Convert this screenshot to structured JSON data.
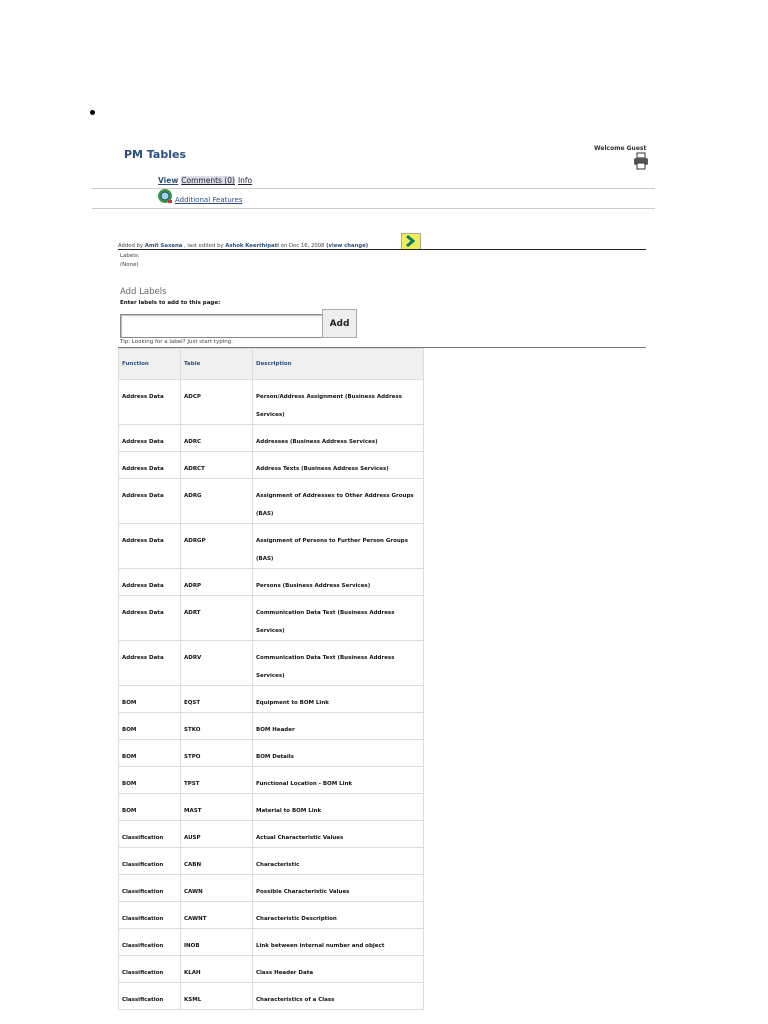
{
  "page": {
    "title": "PM Tables",
    "welcome": "Welcome Guest"
  },
  "tabs": {
    "view": "View",
    "comments": "Comments (0)",
    "info": "Info"
  },
  "additional_features": "Additional Features",
  "meta": {
    "added_by_prefix": "Added by",
    "author": "Amit Saxena",
    "edited_prefix": ", last edited by",
    "editor": "Ashok Keerthipati",
    "date_text": "on Dec 16, 2008",
    "view_change": "(view change)"
  },
  "labels": {
    "heading": "Labels:",
    "value": "(None)"
  },
  "add_labels": {
    "heading": "Add Labels",
    "prompt": "Enter labels to add to this page:",
    "input_value": "",
    "button": "Add",
    "tip": "Tip: Looking for a label? Just start typing."
  },
  "table": {
    "headers": [
      "Function",
      "Table",
      "Description"
    ],
    "rows": [
      [
        "Address Data",
        "ADCP",
        "Person/Address Assignment (Business Address Services)"
      ],
      [
        "Address Data",
        "ADRC",
        "Addresses (Business Address Services)"
      ],
      [
        "Address Data",
        "ADRCT",
        "Address Texts (Business Address Services)"
      ],
      [
        "Address Data",
        "ADRG",
        "Assignment of Addresses to Other Address Groups (BAS)"
      ],
      [
        "Address Data",
        "ADRGP",
        "Assignment of Persons to Further Person Groups (BAS)"
      ],
      [
        "Address Data",
        "ADRP",
        "Persons (Business Address Services)"
      ],
      [
        "Address Data",
        "ADRT",
        "Communication Data Text (Business Address Services)"
      ],
      [
        "Address Data",
        "ADRV",
        "Communication Data Text (Business Address Services)"
      ],
      [
        "BOM",
        "EQST",
        "Equipment to BOM Link"
      ],
      [
        "BOM",
        "STKO",
        "BOM Header"
      ],
      [
        "BOM",
        "STPO",
        "BOM Details"
      ],
      [
        "BOM",
        "TPST",
        "Functional Location - BOM Link"
      ],
      [
        "BOM",
        "MAST",
        "Material to BOM Link"
      ],
      [
        "Classification",
        "AUSP",
        "Actual Characteristic Values"
      ],
      [
        "Classification",
        "CABN",
        "Characteristic"
      ],
      [
        "Classification",
        "CAWN",
        "Possible Characteristic Values"
      ],
      [
        "Classification",
        "CAWNT",
        "Characteristic Description"
      ],
      [
        "Classification",
        "INOB",
        "Link between internal number and object"
      ],
      [
        "Classification",
        "KLAH",
        "Class Header Data"
      ],
      [
        "Classification",
        "KSML",
        "Characteristics of a Class"
      ]
    ]
  }
}
